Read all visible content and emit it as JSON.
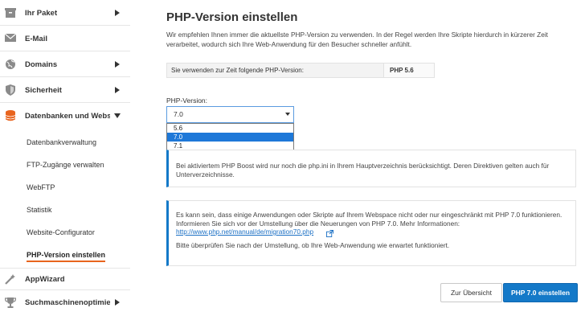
{
  "sidebar": {
    "items": [
      {
        "label": "Ihr Paket",
        "icon": "package-icon",
        "chevron": "right"
      },
      {
        "label": "E-Mail",
        "icon": "mail-icon",
        "chevron": "none"
      },
      {
        "label": "Domains",
        "icon": "globe-icon",
        "chevron": "right"
      },
      {
        "label": "Sicherheit",
        "icon": "shield-icon",
        "chevron": "right"
      },
      {
        "label": "Datenbanken und Websp...",
        "icon": "database-icon",
        "chevron": "down"
      },
      {
        "label": "AppWizard",
        "icon": "wand-icon",
        "chevron": "none"
      },
      {
        "label": "Suchmaschinenoptimieru...",
        "icon": "trophy-icon",
        "chevron": "right"
      }
    ],
    "subitems": [
      {
        "label": "Datenbankverwaltung"
      },
      {
        "label": "FTP-Zugänge verwalten"
      },
      {
        "label": "WebFTP"
      },
      {
        "label": "Statistik"
      },
      {
        "label": "Website-Configurator"
      },
      {
        "label": "PHP-Version einstellen",
        "active": true
      }
    ]
  },
  "main": {
    "title": "PHP-Version einstellen",
    "intro": "Wir empfehlen Ihnen immer die aktuellste PHP-Version zu verwenden. In der Regel werden Ihre Skripte hierdurch in kürzerer Zeit verarbeitet, wodurch sich Ihre Web-Anwendung für den Besucher schneller anfühlt.",
    "current_version_label": "Sie verwenden zur Zeit folgende PHP-Version:",
    "current_version_value": "PHP 5.6",
    "select_label": "PHP-Version:",
    "select_value": "7.0",
    "options": [
      "5.6",
      "7.0",
      "7.1"
    ],
    "selected_option_index": 1,
    "info1": "Bei aktiviertem PHP Boost wird nur noch die php.ini in Ihrem Hauptverzeichnis berücksichtigt. Deren Direktiven gelten auch für Unterverzeichnisse.",
    "info2_text": "Es kann sein, dass einige Anwendungen oder Skripte auf Ihrem Webspace nicht oder nur eingeschränkt mit PHP 7.0 funktionieren. Informieren Sie sich vor der Umstellung über die Neuerungen von PHP 7.0. Mehr Informationen:",
    "info2_link": "http://www.php.net/manual/de/migration70.php",
    "info2_text2": "Bitte überprüfen Sie nach der Umstellung, ob Ihre Web-Anwendung wie erwartet funktioniert.",
    "back_button": "Zur Übersicht",
    "submit_button": "PHP 7.0 einstellen"
  },
  "colors": {
    "accent": "#1479c8",
    "active_underline": "#e8641e",
    "icon_gray": "#8a8a8a",
    "database_icon": "#e8641e"
  }
}
